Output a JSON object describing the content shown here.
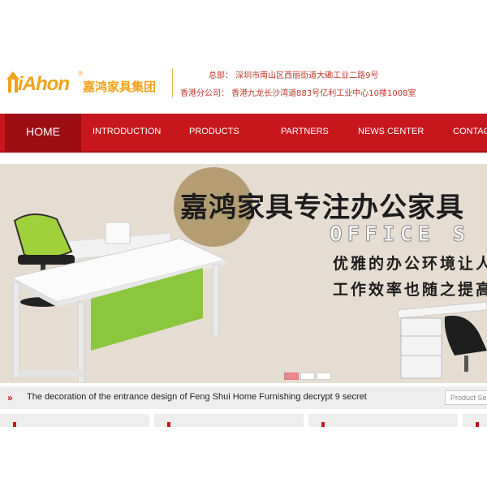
{
  "header": {
    "logo_brand": "iAhon",
    "logo_reg": "®",
    "logo_cn": "嘉鸿家具集团",
    "address_hq": "总部：  深圳市南山区西丽街道大磡工业二路9号",
    "address_hk": "香港分公司：  香港九龙长沙湾道883号亿利工业中心10楼1008室"
  },
  "nav": {
    "items": [
      "HOME",
      "INTRODUCTION",
      "PRODUCTS",
      "PARTNERS",
      "NEWS CENTER",
      "CONTACT"
    ]
  },
  "banner": {
    "title": "嘉鸿家具专注办公家具",
    "line2": "OFFICE S",
    "line3": "优雅的办公环境让人",
    "line4": "工作效率也随之提高",
    "slides": 3,
    "active_slide": 1
  },
  "news": {
    "headline": "The decoration of the entrance design of Feng Shui Home Furnishing decrypt 9 secret",
    "search_placeholder": "Product Se"
  },
  "colors": {
    "brand_red": "#c8161d",
    "brand_orange": "#f0a219",
    "nav_active": "#9e0d13"
  }
}
